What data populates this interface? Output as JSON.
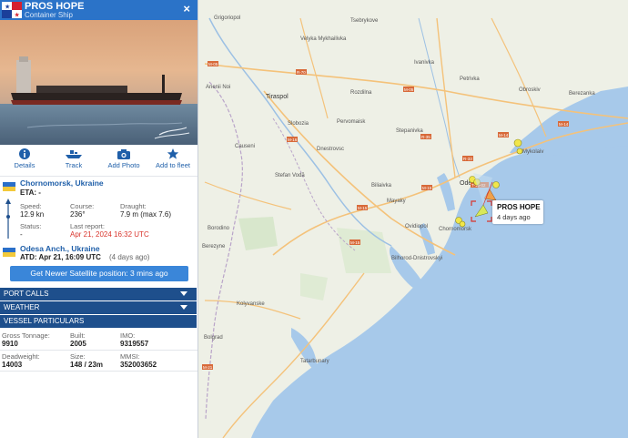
{
  "vessel": {
    "name": "PROS HOPE",
    "type": "Container Ship",
    "close_symbol": "×"
  },
  "actions": [
    {
      "label": "Details",
      "icon": "info-icon"
    },
    {
      "label": "Track",
      "icon": "ship-icon"
    },
    {
      "label": "Add Photo",
      "icon": "camera-icon"
    },
    {
      "label": "Add to fleet",
      "icon": "star-icon"
    }
  ],
  "voyage": {
    "departure_port": "Chornomorsk, Ukraine",
    "eta_text": "ETA: -",
    "speed_label": "Speed:",
    "speed_value": "12.9 kn",
    "course_label": "Course:",
    "course_value": "236°",
    "draught_label": "Draught:",
    "draught_value": "7.9 m (max 7.6)",
    "status_label": "Status:",
    "status_value": "-",
    "last_report_label": "Last report:",
    "last_report_value": "Apr 21, 2024 16:32 UTC",
    "arrival_port": "Odesa Anch., Ukraine",
    "atd_text": "ATD: Apr 21, 16:09 UTC",
    "atd_ago": "(4 days ago)"
  },
  "satellite_button": "Get Newer Satellite position: 3 mins ago",
  "sections": {
    "port_calls": "PORT CALLS",
    "weather": "WEATHER",
    "particulars": "VESSEL PARTICULARS"
  },
  "particulars": {
    "gross_tonnage_label": "Gross Tonnage:",
    "gross_tonnage_value": "9910",
    "built_label": "Built:",
    "built_value": "2005",
    "imo_label": "IMO:",
    "imo_value": "9319557",
    "deadweight_label": "Deadweight:",
    "deadweight_value": "14003",
    "size_label": "Size:",
    "size_value": "148 / 23m",
    "mmsi_label": "MMSI:",
    "mmsi_value": "352003652"
  },
  "map": {
    "vessel_label_name": "PROS HOPE",
    "vessel_label_time": "4 days ago",
    "places": [
      "Grigoriopol",
      "Tsebrykove",
      "Velyka Mykhailivka",
      "Ivanivka",
      "Anenii Noi",
      "Tiraspol",
      "Rozdilna",
      "Petrivka",
      "Obroskiv",
      "Berezanka",
      "Slobozia",
      "Pervomaisk",
      "Stepanivka",
      "Causeni",
      "Dnestrovsc",
      "Stefan Vodă",
      "Biliaivka",
      "Mykolaiv",
      "Odesa",
      "Mayaky",
      "Chornomorsk",
      "Borodino",
      "Ovidiopol",
      "Berezyne",
      "Bilhorod-Dnistrovskyi",
      "Kolyvanske",
      "Tatarbunary",
      "Bolgrad"
    ],
    "roads": [
      "M-05",
      "M-14",
      "M-15",
      "M-16",
      "R-33",
      "R-70",
      "R-35",
      "T-16-02",
      "M-21"
    ]
  },
  "colors": {
    "header_blue": "#2b73c8",
    "section_bar": "#1e4f8c",
    "button_blue": "#3a86d9",
    "link_blue": "#1f5fa9",
    "alert_red": "#d9342b",
    "sea": "#a7c9ea",
    "land": "#eef0e6"
  }
}
